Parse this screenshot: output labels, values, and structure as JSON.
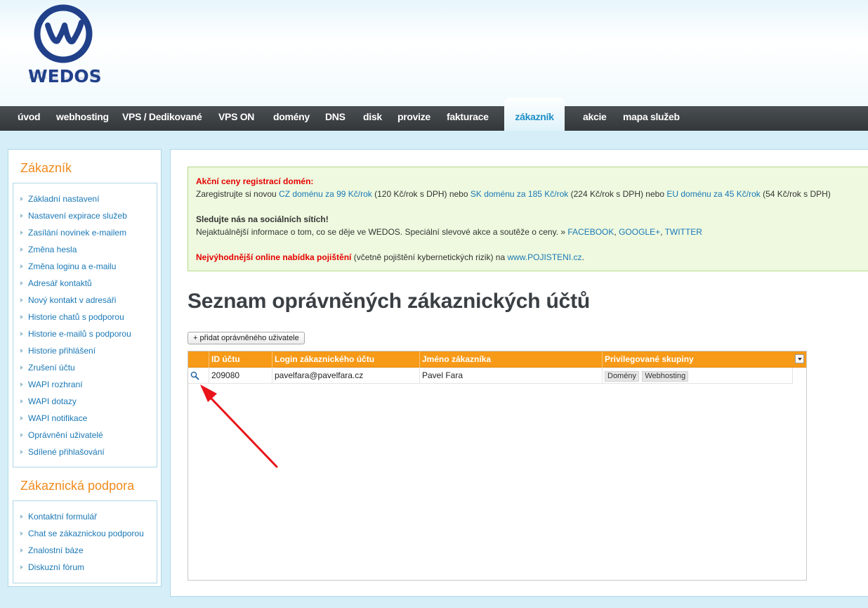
{
  "brand": {
    "logo_text": "WEDOS",
    "accent": "#f08b1d",
    "link": "#1a78b6",
    "nav_active": "#1e8fc6"
  },
  "nav": {
    "items": [
      {
        "label": "úvod"
      },
      {
        "label": "webhosting"
      },
      {
        "label": "VPS / Dedikované"
      },
      {
        "label": "VPS ON"
      },
      {
        "label": "domény"
      },
      {
        "label": "DNS"
      },
      {
        "label": "disk"
      },
      {
        "label": "provize"
      },
      {
        "label": "fakturace"
      },
      {
        "label": "zákazník"
      },
      {
        "label": "akcie"
      },
      {
        "label": "mapa služeb"
      }
    ],
    "active": "zákazník"
  },
  "sidebar": {
    "customer_title": "Zákazník",
    "customer_links": [
      {
        "label": "Základní nastavení"
      },
      {
        "label": "Nastavení expirace služeb"
      },
      {
        "label": "Zasílání novinek e-mailem"
      },
      {
        "label": "Změna hesla"
      },
      {
        "label": "Změna loginu a e-mailu"
      },
      {
        "label": "Adresář kontaktů"
      },
      {
        "label": "Nový kontakt v adresáři"
      },
      {
        "label": "Historie chatů s podporou"
      },
      {
        "label": "Historie e-mailů s podporou"
      },
      {
        "label": "Historie přihlášení"
      },
      {
        "label": "Zrušení účtu"
      },
      {
        "label": "WAPI rozhraní"
      },
      {
        "label": "WAPI dotazy"
      },
      {
        "label": "WAPI notifikace"
      },
      {
        "label": "Oprávnění uživatelé"
      },
      {
        "label": "Sdílené přihlašování"
      }
    ],
    "support_title": "Zákaznická podpora",
    "support_links": [
      {
        "label": "Kontaktní formulář"
      },
      {
        "label": "Chat se zákaznickou podporou"
      },
      {
        "label": "Znalostní báze"
      },
      {
        "label": "Diskuzní fórum"
      }
    ]
  },
  "promo": {
    "heading": "Akční ceny registrací domén:",
    "line1_a": "Zaregistrujte si novou ",
    "cz_link": "CZ doménu za 99 Kč/rok",
    "line1_b": " (120 Kč/rok s DPH) nebo ",
    "sk_link": "SK doménu za 185 Kč/rok",
    "line1_c": " (224 Kč/rok s DPH) nebo ",
    "eu_link": "EU doménu za 45 Kč/rok",
    "line1_d": " (54 Kč/rok s DPH)",
    "social_heading": "Sledujte nás na sociálních sítích!",
    "social_text": "Nejaktuálnější informace o tom, co se děje ve WEDOS. Speciální slevové akce a soutěže o ceny. » ",
    "facebook": "FACEBOOK",
    "comma1": ", ",
    "google": "GOOGLE+",
    "comma2": ", ",
    "twitter": "TWITTER",
    "insurance_strong": "Nejvýhodnější online nabídka pojištění",
    "insurance_text": " (včetně pojištění kybernetických rizik) na ",
    "insurance_link": "www.POJISTENI.cz",
    "insurance_end": "."
  },
  "main": {
    "title": "Seznam oprávněných zákaznických účtů",
    "add_button": "+ přidat oprávněného uživatele"
  },
  "table": {
    "columns": [
      "ID účtu",
      "Login zákaznického účtu",
      "Jméno zákazníka",
      "Privilegované skupiny"
    ],
    "rows": [
      {
        "id": "209080",
        "login": "pavelfara@pavelfara.cz",
        "name": "Pavel Fara",
        "groups": [
          "Domény",
          "Webhosting"
        ]
      }
    ]
  }
}
